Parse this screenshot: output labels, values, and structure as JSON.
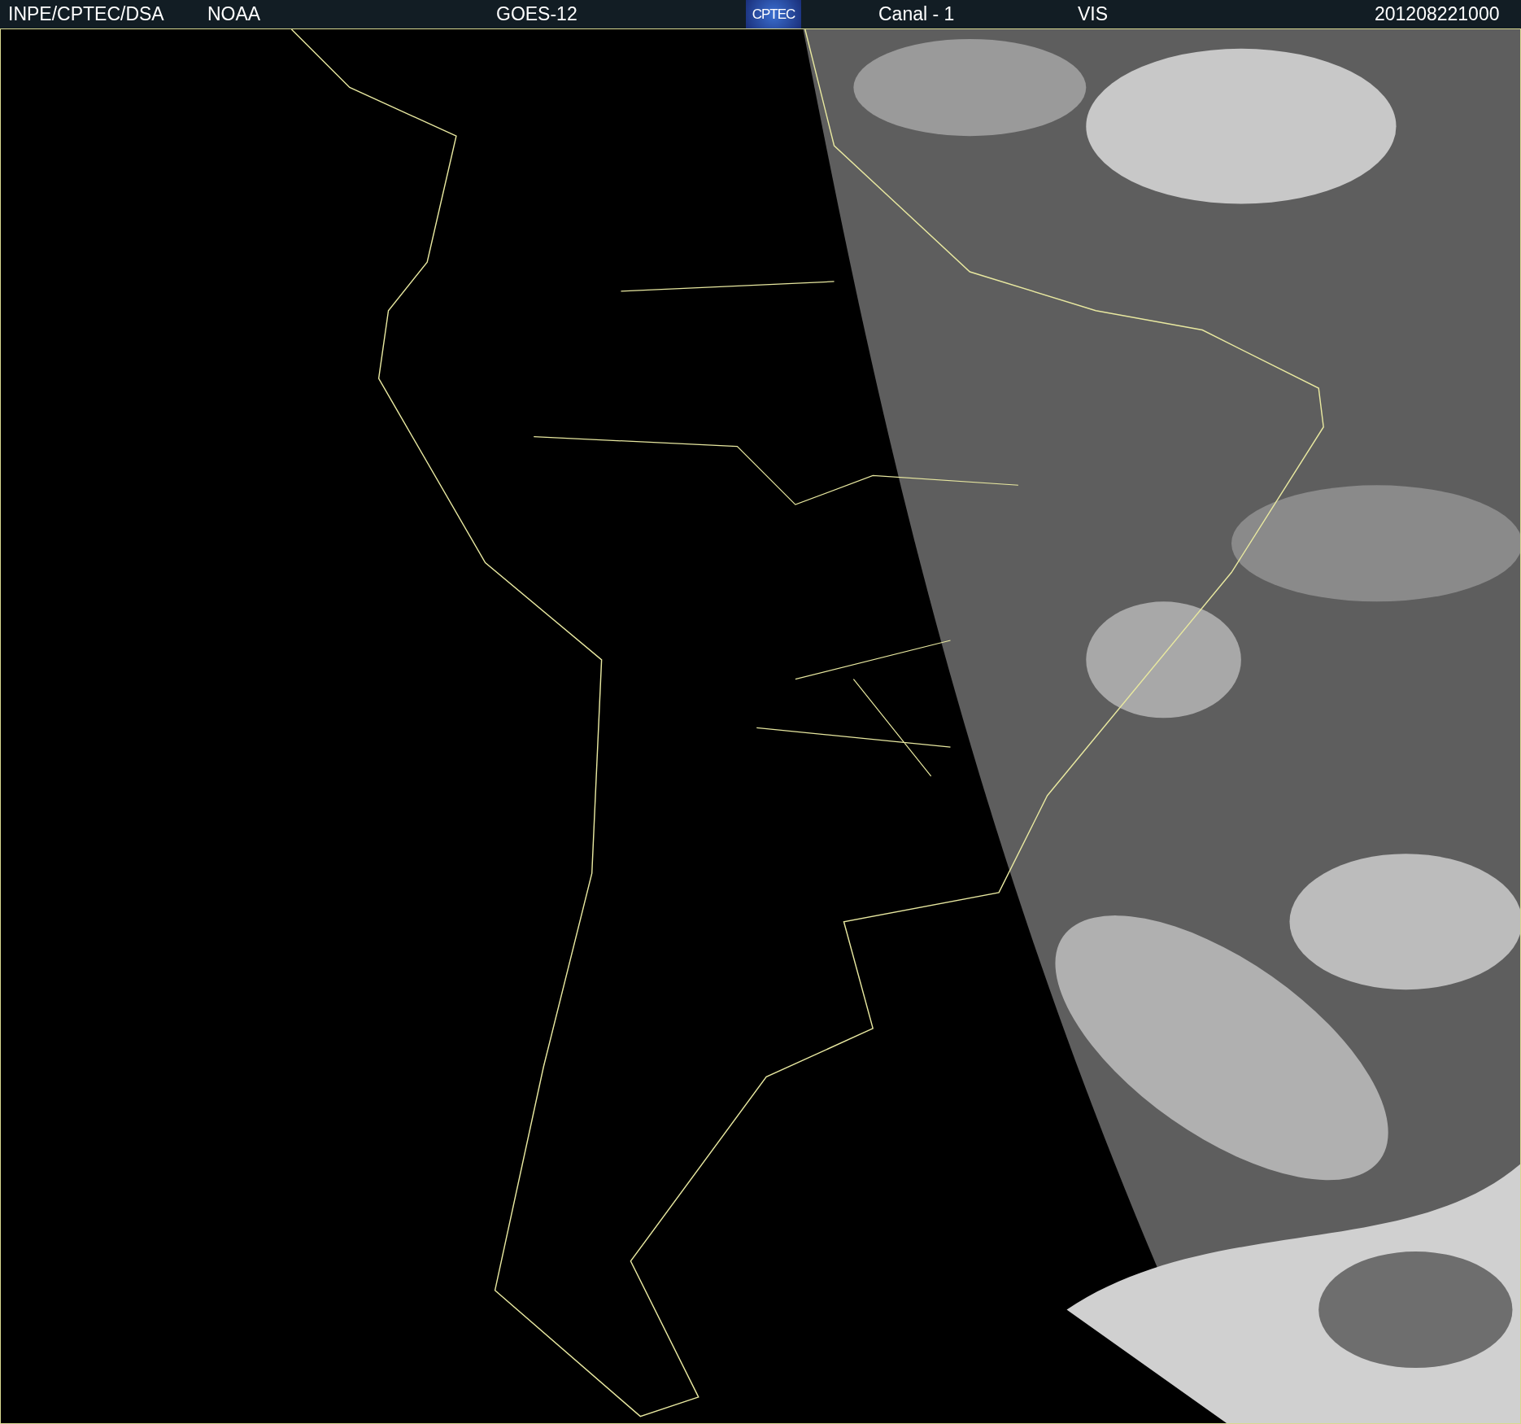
{
  "header": {
    "source": "INPE/CPTEC/DSA",
    "agency": "NOAA",
    "satellite": "GOES-12",
    "logo": "CPTEC",
    "channel": "Canal - 1",
    "band": "VIS",
    "timestamp": "201208221000"
  }
}
